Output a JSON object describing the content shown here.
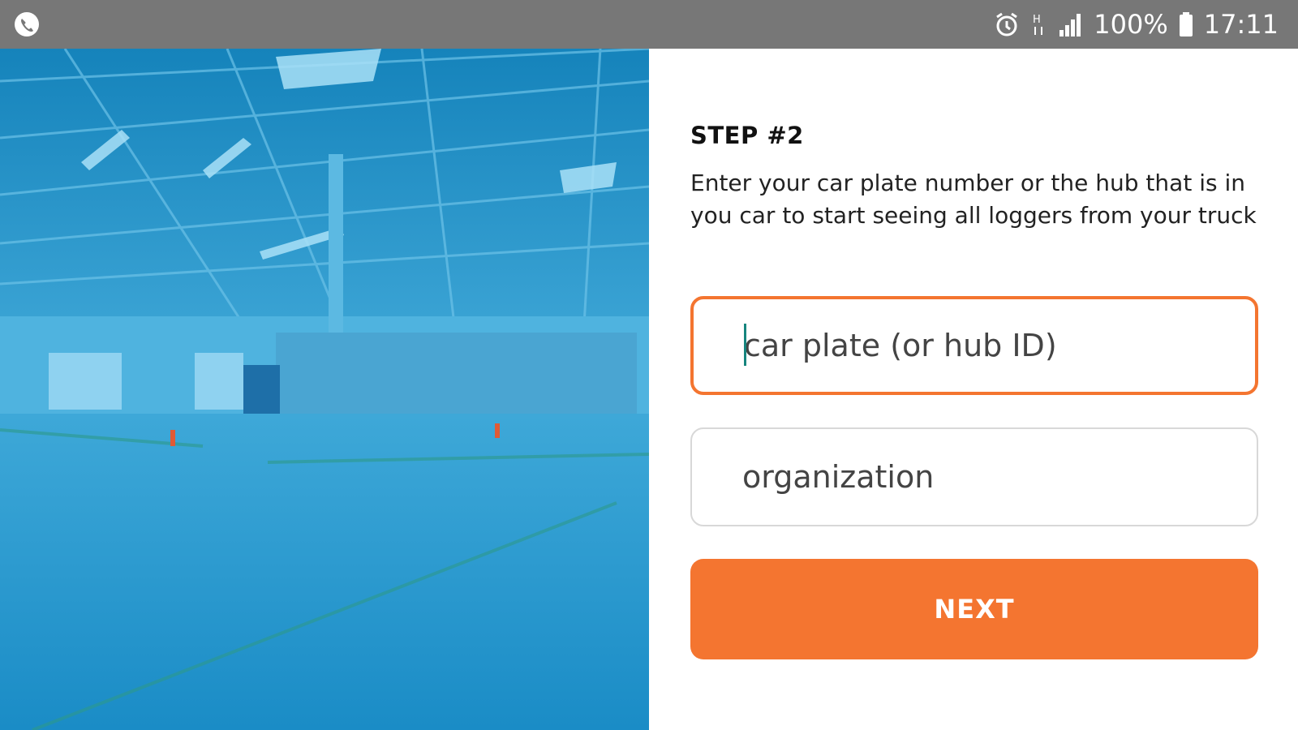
{
  "status_bar": {
    "left_icon": "phone-call-icon",
    "icons": [
      "alarm-clock-icon",
      "signal-h-icon",
      "cell-signal-icon",
      "battery-icon"
    ],
    "battery_percent": "100%",
    "time": "17:11"
  },
  "hero": {
    "image": "warehouse-truck-photo",
    "tint_color": "#1790c6"
  },
  "form": {
    "step_title": "STEP #2",
    "description": "Enter your car plate number or the hub that is in you car to start seeing all loggers from your truck",
    "plate_field": {
      "placeholder": "car plate (or hub ID)",
      "value": ""
    },
    "organization_field": {
      "placeholder": "organization",
      "value": ""
    },
    "next_button": "NEXT"
  },
  "colors": {
    "accent": "#f47530",
    "status_bar": "#777777",
    "focus_border": "#f47530",
    "field_border": "#d8d8d8",
    "caret": "#16857e"
  }
}
